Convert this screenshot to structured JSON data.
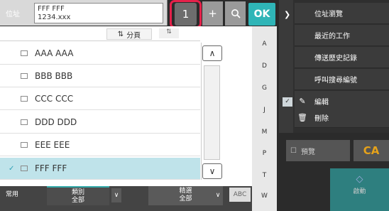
{
  "address": {
    "label": "位址",
    "line1": "FFF FFF",
    "line2": "1234.xxx"
  },
  "toolbar": {
    "count": "1",
    "add_icon": "+",
    "search_icon": "search-icon",
    "ok_label": "OK"
  },
  "right_menu": [
    {
      "label": "位址瀏覽",
      "icon": ""
    },
    {
      "label": "最近的工作",
      "icon": ""
    },
    {
      "label": "傳送歷史記錄",
      "icon": ""
    },
    {
      "label": "呼叫搜尋編號",
      "icon": ""
    },
    {
      "label": "編輯",
      "icon": "edit-icon"
    },
    {
      "label": "刪除",
      "icon": "trash-icon"
    }
  ],
  "sort": {
    "page_label": "分頁"
  },
  "contacts": [
    {
      "name": "AAA AAA",
      "selected": false
    },
    {
      "name": "BBB BBB",
      "selected": false
    },
    {
      "name": "CCC CCC",
      "selected": false
    },
    {
      "name": "DDD DDD",
      "selected": false
    },
    {
      "name": "EEE EEE",
      "selected": false
    },
    {
      "name": "FFF FFF",
      "selected": true
    }
  ],
  "alpha_index": [
    "A",
    "D",
    "G",
    "J",
    "M",
    "P",
    "T",
    "W"
  ],
  "bottom": {
    "common": "常用",
    "category_title": "類別",
    "category_value": "全部",
    "select_title": "精選",
    "select_value": "全部",
    "abc": "ABC"
  },
  "actions": {
    "preview": "預覽",
    "ca": "CA",
    "start": "啟動"
  },
  "colors": {
    "accent": "#2fb5b7",
    "highlight": "#e5214a",
    "selected_row": "#bfe3ea",
    "start": "#2e7f7f"
  }
}
